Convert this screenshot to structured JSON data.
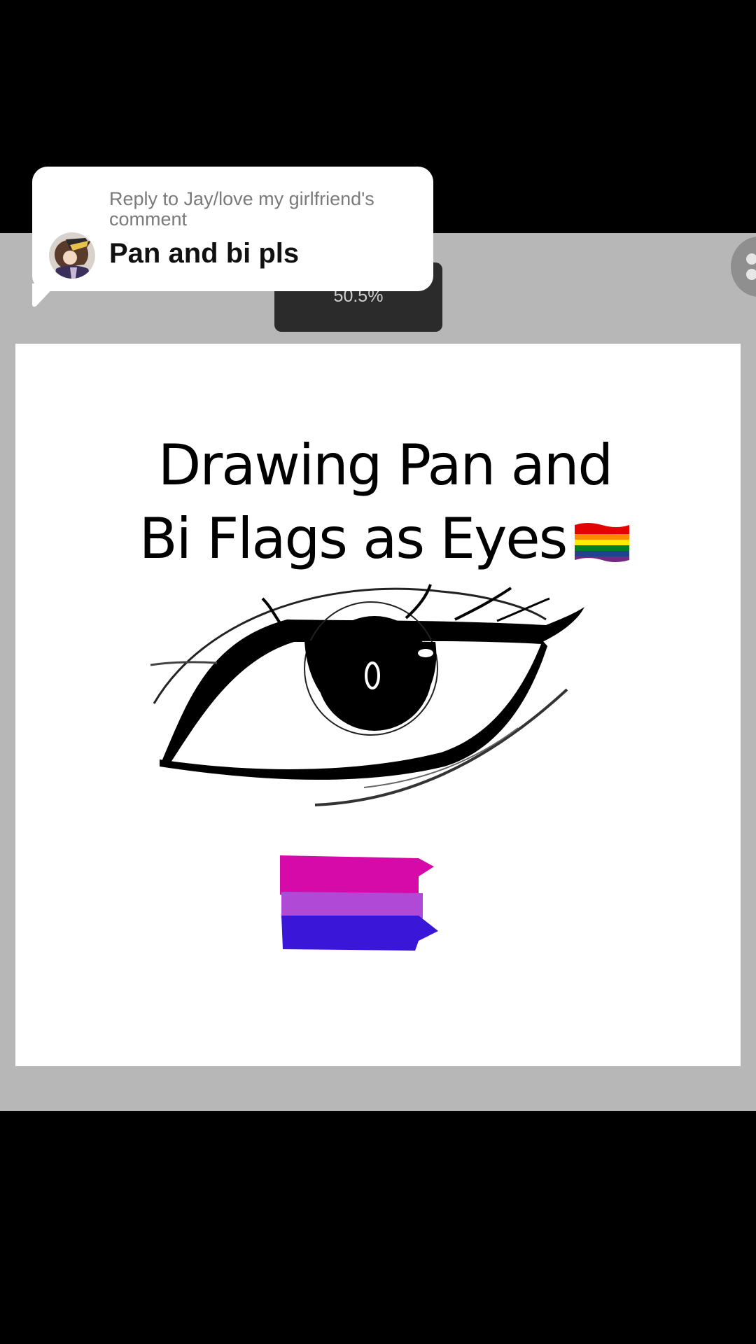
{
  "reply": {
    "header": "Reply to Jay/love my girlfriend's comment",
    "text": "Pan and bi pls"
  },
  "zoom_label": "50.5%",
  "overlay_title": {
    "line1": "Drawing Pan and",
    "line2": "Bi Flags as Eyes"
  },
  "icons": {
    "rainbow_flag": "rainbow-flag-emoji",
    "avatar": "user-avatar",
    "side_button": "menu-button"
  },
  "colors": {
    "background": "#000000",
    "app_frame": "#b7b7b7",
    "canvas": "#ffffff",
    "bi_pink": "#d60aa8",
    "bi_purple": "#b04ad6",
    "bi_blue": "#3a17d8"
  }
}
